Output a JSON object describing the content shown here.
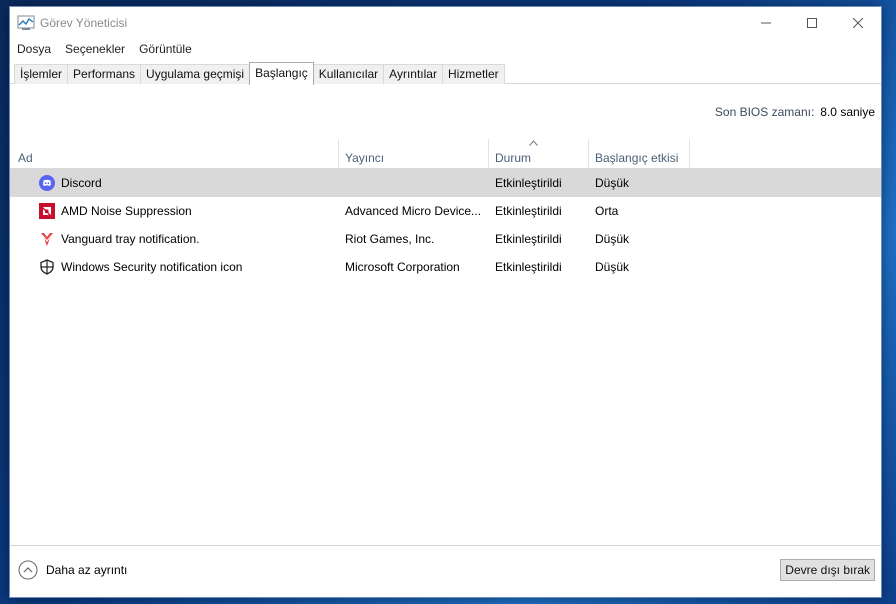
{
  "window": {
    "title": "Görev Yöneticisi",
    "controls": {
      "minimize": "—",
      "maximize": "☐",
      "close": "✕"
    }
  },
  "menu": [
    "Dosya",
    "Seçenekler",
    "Görüntüle"
  ],
  "tabs": [
    "İşlemler",
    "Performans",
    "Uygulama geçmişi",
    "Başlangıç",
    "Kullanıcılar",
    "Ayrıntılar",
    "Hizmetler"
  ],
  "active_tab": "Başlangıç",
  "bios": {
    "label": "Son BIOS zamanı:",
    "value": "8.0 saniye"
  },
  "columns": {
    "name": "Ad",
    "publisher": "Yayıncı",
    "status": "Durum",
    "impact": "Başlangıç etkisi"
  },
  "rows": [
    {
      "icon": "discord-icon",
      "name": "Discord",
      "publisher": "",
      "status": "Etkinleştirildi",
      "impact": "Düşük",
      "selected": true
    },
    {
      "icon": "amd-icon",
      "name": "AMD Noise Suppression",
      "publisher": "Advanced Micro Device...",
      "status": "Etkinleştirildi",
      "impact": "Orta",
      "selected": false
    },
    {
      "icon": "vanguard-icon",
      "name": "Vanguard tray notification.",
      "publisher": "Riot Games, Inc.",
      "status": "Etkinleştirildi",
      "impact": "Düşük",
      "selected": false
    },
    {
      "icon": "shield-icon",
      "name": "Windows Security notification icon",
      "publisher": "Microsoft Corporation",
      "status": "Etkinleştirildi",
      "impact": "Düşük",
      "selected": false
    }
  ],
  "footer": {
    "fewer_details": "Daha az ayrıntı",
    "disable_button": "Devre dışı bırak"
  },
  "colors": {
    "accent": "#0078d7",
    "selected_row": "#d9d9d9",
    "header_text": "#4c607a",
    "discord": "#5865f2",
    "amd": "#c8102e",
    "vanguard": "#e84142"
  }
}
